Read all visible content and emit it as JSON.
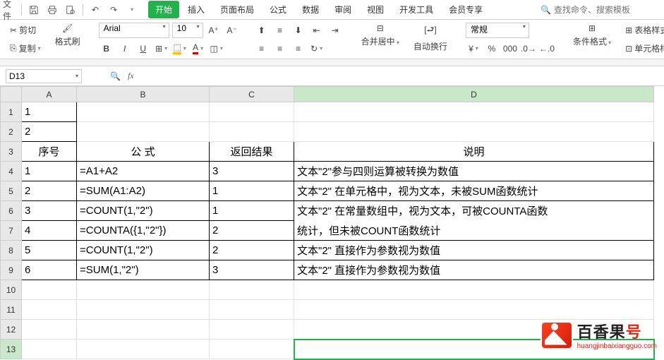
{
  "quick_access": {
    "file_label": "文件"
  },
  "tabs": {
    "start": "开始",
    "insert": "插入",
    "page_layout": "页面布局",
    "formulas": "公式",
    "data": "数据",
    "review": "审阅",
    "view": "视图",
    "dev_tools": "开发工具",
    "member": "会员专享"
  },
  "search": {
    "placeholder": "查找命令、搜索模板"
  },
  "ribbon": {
    "cut": "剪切",
    "copy": "复制",
    "format_painter": "格式刷",
    "font": "Arial",
    "font_size": "10",
    "merge_center": "合并居中",
    "wrap_text": "自动换行",
    "number_format": "常规",
    "cond_format": "条件格式",
    "table_style": "表格样式",
    "cell_style": "单元格样"
  },
  "name_box": "D13",
  "columns": {
    "A": "A",
    "B": "B",
    "C": "C",
    "D": "D"
  },
  "col_widths": {
    "A": 78,
    "B": 188,
    "C": 120,
    "D": 510
  },
  "row_headers": [
    "1",
    "2",
    "3",
    "4",
    "5",
    "6",
    "7",
    "8",
    "9",
    "10",
    "11",
    "12",
    "13"
  ],
  "sheet": {
    "a1": "1",
    "a2": "2",
    "hdr_seq": "序号",
    "hdr_formula": "公 式",
    "hdr_result": "返回结果",
    "hdr_desc": "说明",
    "rows": [
      {
        "n": "1",
        "f": "=A1+A2",
        "r": "3",
        "d": "文本\"2\"参与四则运算被转换为数值"
      },
      {
        "n": "2",
        "f": "=SUM(A1:A2)",
        "r": "1",
        "d": "文本\"2\"  在单元格中，视为文本，未被SUM函数统计"
      },
      {
        "n": "3",
        "f": "=COUNT(1,\"2\")",
        "r": "1",
        "d": "文本\"2\"  在常量数组中，视为文本，可被COUNTA函数"
      },
      {
        "n": "4",
        "f": "=COUNTA({1,\"2\"})",
        "r": "2",
        "d": "统计，但未被COUNT函数统计"
      },
      {
        "n": "5",
        "f": "=COUNT(1,\"2\")",
        "r": "2",
        "d": "文本\"2\"  直接作为参数视为数值"
      },
      {
        "n": "6",
        "f": "=SUM(1,\"2\")",
        "r": "3",
        "d": "文本\"2\"  直接作为参数视为数值"
      }
    ]
  },
  "watermark": {
    "title_main": "百香果",
    "title_last": "号",
    "sub": "huangjinbaixiangguo.com"
  }
}
